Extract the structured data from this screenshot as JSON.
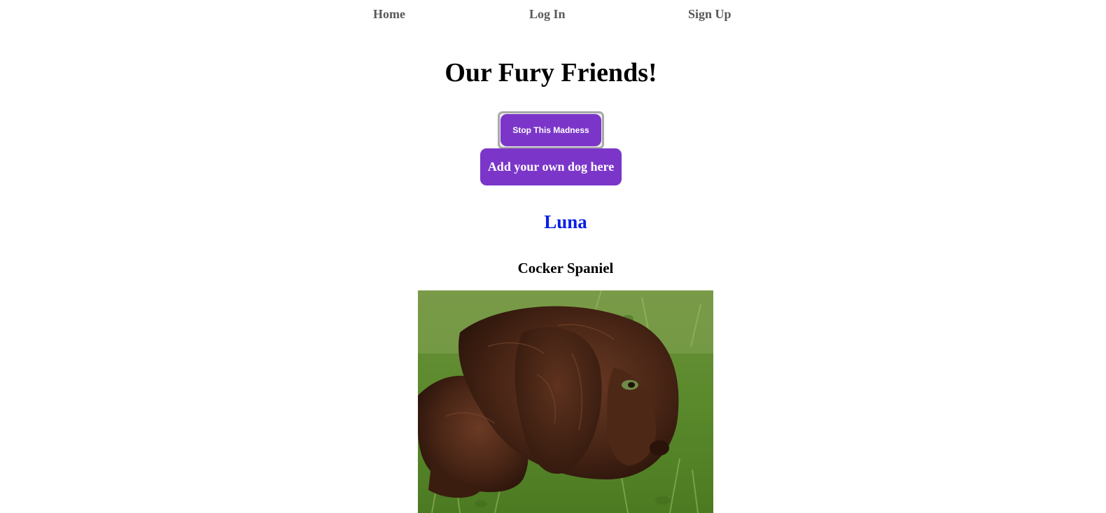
{
  "nav": {
    "home": "Home",
    "login": "Log In",
    "signup": "Sign Up"
  },
  "page": {
    "title": "Our Fury Friends!"
  },
  "buttons": {
    "stop": "Stop This Madness",
    "add_dog": "Add your own dog here"
  },
  "dog": {
    "name": "Luna",
    "breed": "Cocker Spaniel",
    "photo_subject": "brown cocker spaniel puppy lying on grass"
  },
  "colors": {
    "button_purple": "#7b36c9",
    "link_blue": "#0a1ee8",
    "nav_gray": "#595959"
  }
}
